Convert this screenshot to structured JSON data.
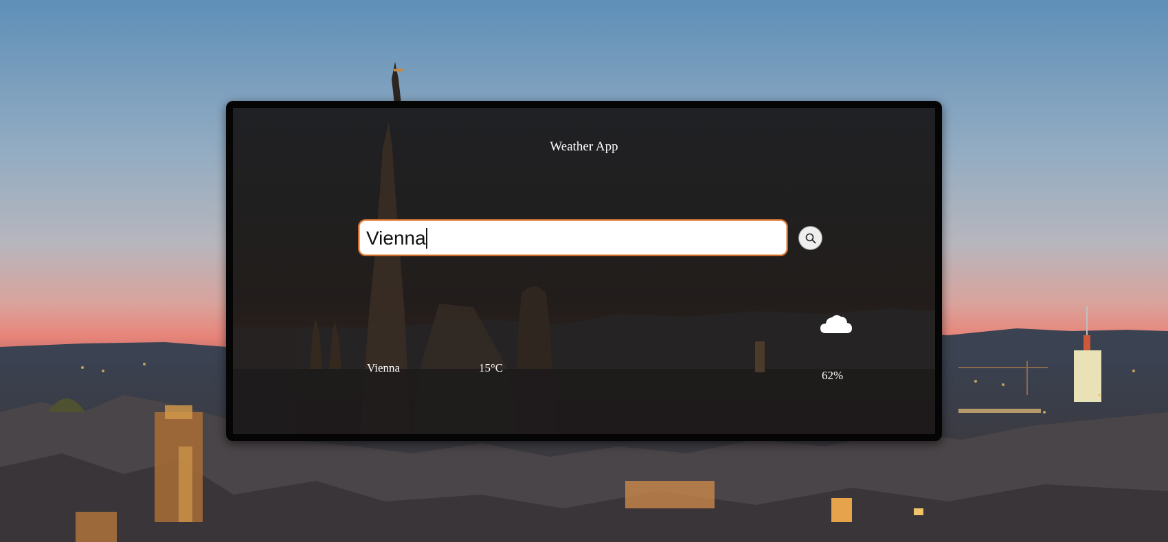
{
  "app": {
    "title": "Weather App"
  },
  "search": {
    "value": "Vienna"
  },
  "result": {
    "city": "Vienna",
    "temperature": "15°C",
    "humidity": "62%",
    "condition_icon": "cloud-icon"
  },
  "icons": {
    "search": "search-icon"
  },
  "colors": {
    "accent": "#c96a2c",
    "card_border": "#050505",
    "text": "#ffffff",
    "sky_top": "#5e8fb8",
    "sky_sunset": "#e8857a"
  }
}
